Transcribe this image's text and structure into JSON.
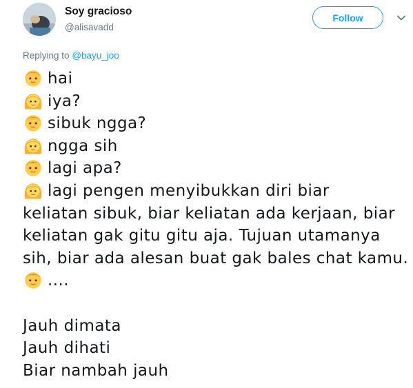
{
  "author": {
    "display_name": "Soy gracioso",
    "handle": "@alisavadd",
    "avatar_icon": "user-avatar"
  },
  "follow_button": {
    "label": "Follow",
    "color": "#1da1f2"
  },
  "more_menu_icon": "chevron-down-icon",
  "reply": {
    "prefix": "Replying to",
    "target": "@bayu_joo"
  },
  "tweet": {
    "lines": [
      {
        "emoji": "boy-face-icon",
        "text": "hai"
      },
      {
        "emoji": "girl-face-icon",
        "text": "iya?"
      },
      {
        "emoji": "boy-face-icon",
        "text": "sibuk ngga?"
      },
      {
        "emoji": "girl-face-icon",
        "text": "ngga sih"
      },
      {
        "emoji": "boy-face-icon",
        "text": "lagi apa?"
      },
      {
        "emoji": "girl-face-icon",
        "text": "lagi pengen menyibukkan diri biar"
      },
      {
        "emoji": "",
        "text": "keliatan sibuk, biar keliatan ada kerjaan, biar"
      },
      {
        "emoji": "",
        "text": "keliatan gak gitu gitu aja. Tujuan utamanya"
      },
      {
        "emoji": "",
        "text": "sih, biar ada alesan buat gak bales chat kamu."
      },
      {
        "emoji": "boy-face-icon",
        "text": "...."
      },
      {
        "emoji": "",
        "text": ""
      },
      {
        "emoji": "",
        "text": "Jauh dimata"
      },
      {
        "emoji": "",
        "text": "Jauh dihati"
      },
      {
        "emoji": "",
        "text": "Biar nambah jauh"
      }
    ]
  }
}
